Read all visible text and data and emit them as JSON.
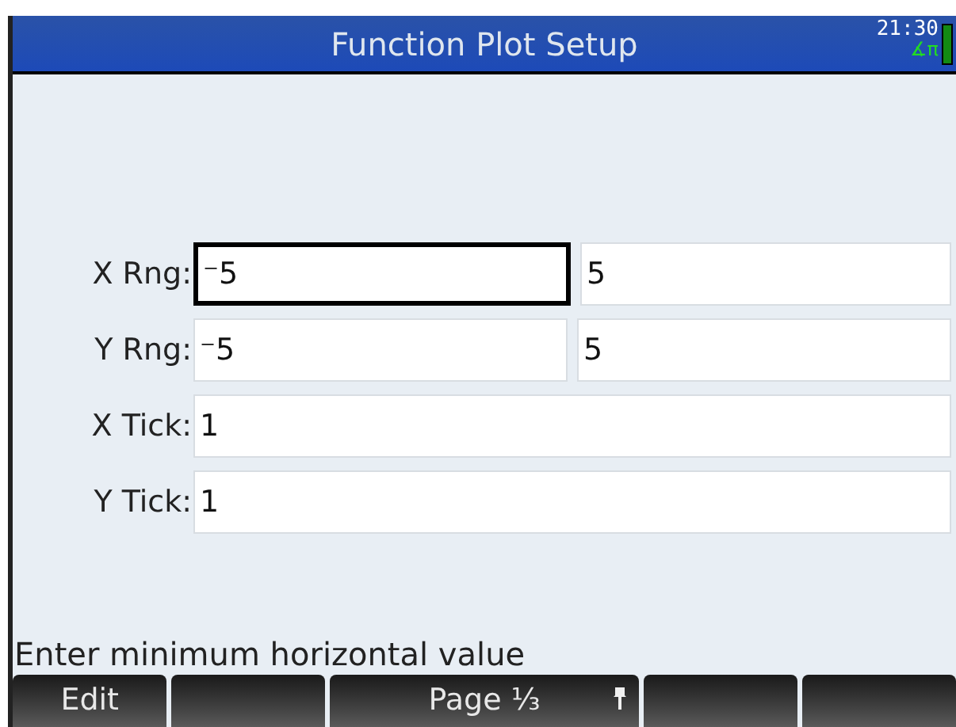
{
  "title": "Function Plot Setup",
  "status": {
    "time": "21:30",
    "angle_mode": "∡π"
  },
  "rows": [
    {
      "label": "X Rng:",
      "fields": [
        {
          "value": "⁻5",
          "selected": true
        },
        {
          "value": "5",
          "selected": false
        }
      ]
    },
    {
      "label": "Y Rng:",
      "fields": [
        {
          "value": "⁻5",
          "selected": false
        },
        {
          "value": "5",
          "selected": false
        }
      ]
    },
    {
      "label": "X Tick:",
      "fields": [
        {
          "value": "1",
          "selected": false
        }
      ]
    },
    {
      "label": "Y Tick:",
      "fields": [
        {
          "value": "1",
          "selected": false
        }
      ]
    }
  ],
  "help_text": "Enter minimum horizontal value",
  "soft_keys": [
    {
      "kind": "plain",
      "label": "Edit"
    },
    {
      "kind": "plain"
    },
    {
      "kind": "menu",
      "label": "Page ⅓"
    },
    {
      "kind": "plain"
    },
    {
      "kind": "plain"
    }
  ]
}
